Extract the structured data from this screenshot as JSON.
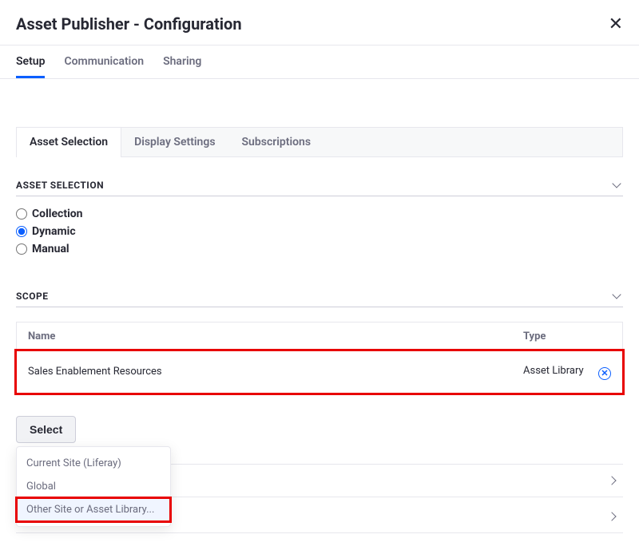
{
  "header": {
    "title": "Asset Publisher - Configuration"
  },
  "primaryTabs": {
    "items": [
      "Setup",
      "Communication",
      "Sharing"
    ],
    "active": 0
  },
  "subTabs": {
    "items": [
      "Asset Selection",
      "Display Settings",
      "Subscriptions"
    ],
    "active": 0
  },
  "sections": {
    "assetSelection": {
      "title": "ASSET SELECTION",
      "options": [
        "Collection",
        "Dynamic",
        "Manual"
      ],
      "selected": "Dynamic"
    },
    "scope": {
      "title": "SCOPE",
      "columns": {
        "name": "Name",
        "type": "Type"
      },
      "rows": [
        {
          "name": "Sales Enablement Resources",
          "type": "Asset Library"
        }
      ]
    }
  },
  "selectButton": {
    "label": "Select",
    "dropdown": [
      "Current Site (Liferay)",
      "Global",
      "Other Site or Asset Library..."
    ]
  }
}
